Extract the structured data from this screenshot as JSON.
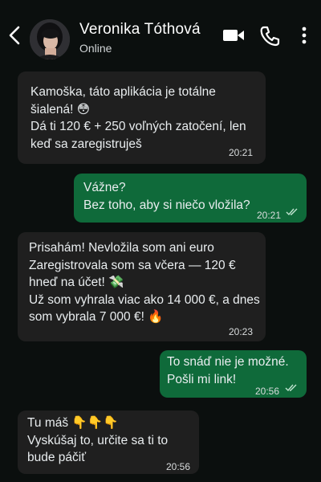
{
  "header": {
    "contact_name": "Veronika Tóthová",
    "status": "Online",
    "icons": [
      "back-arrow-icon",
      "video-call-icon",
      "phone-call-icon",
      "more-options-icon"
    ]
  },
  "messages": [
    {
      "direction": "incoming",
      "text": "Kamoška, táto aplikácia je totálne šialená! 😳\nDá ti 120 € + 250 voľných zatočení, len keď sa zaregistruješ",
      "time": "20:21"
    },
    {
      "direction": "outgoing",
      "text": "Vážne?\nBez toho, aby si niečo vložila?",
      "time": "20:21",
      "read": true
    },
    {
      "direction": "incoming",
      "text": "Prisahám! Nevložila som ani euro\nZaregistrovala som sa včera — 120 € hneď na účet! 💸\nUž som vyhrala viac ako 14 000 €, a dnes som vybrala 7 000 €! 🔥",
      "time": "20:23"
    },
    {
      "direction": "outgoing",
      "text": "To snáď nie je možné.\nPošli mi link!",
      "time": "20:56",
      "read": true
    },
    {
      "direction": "incoming",
      "text": "Tu máš 👇👇👇\nVyskúšaj to, určite sa ti to bude páčiť",
      "time": "20:56"
    }
  ],
  "colors": {
    "background": "#0b0f0e",
    "incoming_bubble": "#1f1f1f",
    "outgoing_bubble": "#0f6a3a",
    "read_ticks": "#bfe3cf"
  }
}
